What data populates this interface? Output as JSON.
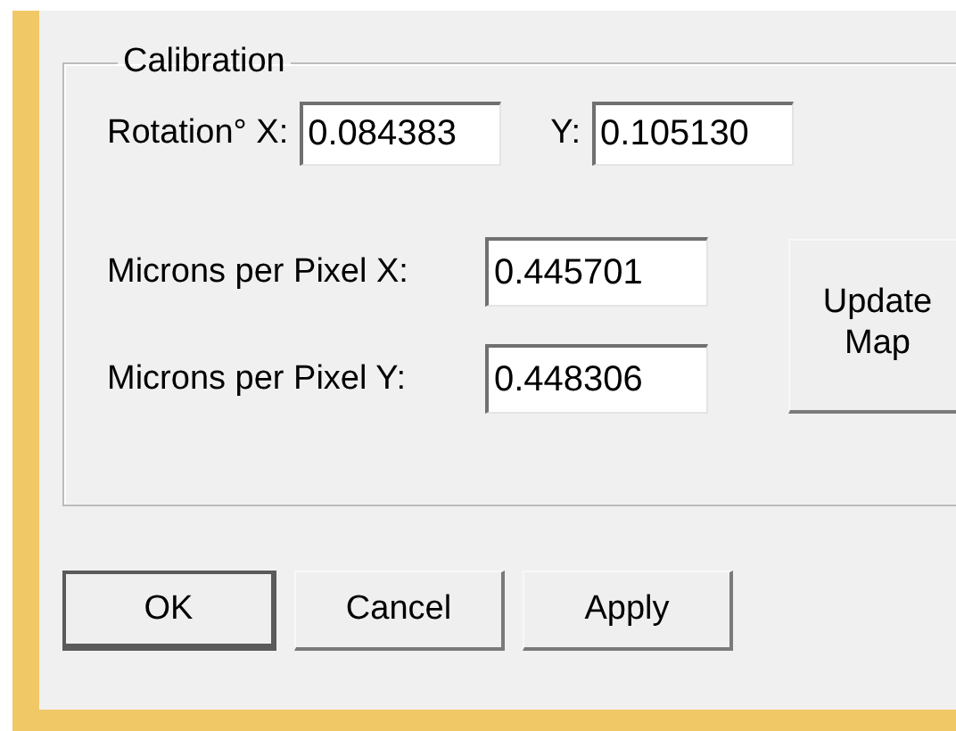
{
  "group": {
    "title": "Calibration",
    "rotation": {
      "label": "Rotation° X:",
      "x_value": "0.084383",
      "y_label": "Y:",
      "y_value": "0.105130"
    },
    "microns": [
      {
        "label": "Microns per Pixel X:",
        "value": "0.445701"
      },
      {
        "label": "Microns per Pixel Y:",
        "value": "0.448306"
      }
    ],
    "update_button": "Update Map"
  },
  "buttons": [
    {
      "label": "OK",
      "default": true
    },
    {
      "label": "Cancel",
      "default": false
    },
    {
      "label": "Apply",
      "default": false
    }
  ]
}
